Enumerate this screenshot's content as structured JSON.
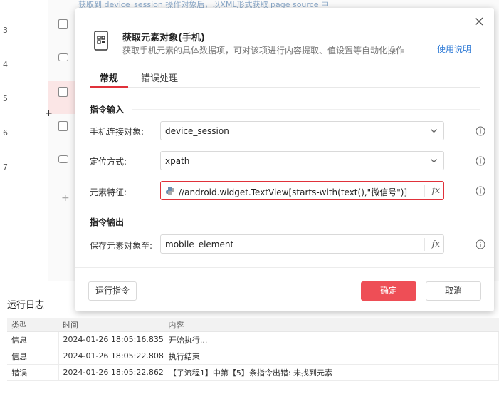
{
  "background": {
    "hint_text": "获取到 device_session 操作对象后，以XML形式获取 page source 中",
    "line_numbers": [
      "3",
      "4",
      "5",
      "6",
      "7"
    ]
  },
  "dialog": {
    "title": "获取元素对象(手机)",
    "subtitle": "获取手机元素的具体数据项，可对该项进行内容提取、值设置等自动化操作",
    "help_link": "使用说明",
    "tabs": [
      {
        "label": "常规",
        "active": true
      },
      {
        "label": "错误处理",
        "active": false
      }
    ],
    "input_section": "指令输入",
    "output_section": "指令输出",
    "fields": {
      "device": {
        "label": "手机连接对象:",
        "value": "device_session"
      },
      "locate": {
        "label": "定位方式:",
        "value": "xpath"
      },
      "feature": {
        "label": "元素特征:",
        "value": "//android.widget.TextView[starts-with(text(),\"微信号\")]"
      },
      "save": {
        "label": "保存元素对象至:",
        "value": "mobile_element"
      }
    },
    "fx_label": "fx",
    "buttons": {
      "run": "运行指令",
      "ok": "确定",
      "cancel": "取消"
    }
  },
  "log": {
    "title": "运行日志",
    "columns": [
      "类型",
      "时间",
      "内容"
    ],
    "rows": [
      {
        "type": "信息",
        "time": "2024-01-26 18:05:16.835",
        "content": "开始执行..."
      },
      {
        "type": "信息",
        "time": "2024-01-26 18:05:22.808",
        "content": "执行结束"
      },
      {
        "type": "错误",
        "time": "2024-01-26 18:05:22.862",
        "content": "【子流程1】中第【5】条指令出错: 未找到元素"
      }
    ]
  },
  "colors": {
    "accent": "#e0313a",
    "ok_button": "#ee4e56",
    "link": "#2e7ad6"
  }
}
